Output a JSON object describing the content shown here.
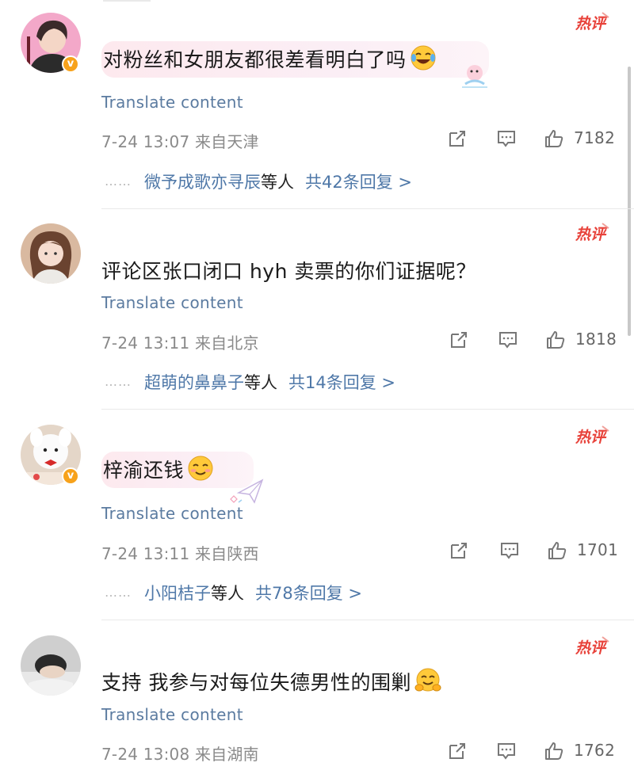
{
  "translate_label": "Translate content",
  "hot_badge_label": "热评",
  "comments": [
    {
      "text": "对粉丝和女朋友都很差看明白了吗",
      "emoji": "laughing-tears-emoji",
      "verified": true,
      "meta": "7-24 13:07  来自天津",
      "likes": "7182",
      "replies": {
        "dots": "……",
        "names": "微予成歌亦寻辰",
        "etc": "等人",
        "total": "共42条回复 >"
      }
    },
    {
      "text": "评论区张口闭口 hyh 卖票的你们证据呢？",
      "emoji": "",
      "verified": false,
      "meta": "7-24 13:11  来自北京",
      "likes": "1818",
      "replies": {
        "dots": "……",
        "names": "超萌的鼻鼻子",
        "etc": "等人",
        "total": "共14条回复 >"
      }
    },
    {
      "text": "梓渝还钱",
      "emoji": "smiling-blush-emoji",
      "verified": true,
      "meta": "7-24 13:11  来自陕西",
      "likes": "1701",
      "replies": {
        "dots": "……",
        "names": "小阳桔子",
        "etc": "等人",
        "total": "共78条回复 >"
      }
    },
    {
      "text": "支持 我参与对每位失德男性的围剿",
      "emoji": "hugging-face-emoji",
      "verified": false,
      "meta": "7-24 13:08  来自湖南",
      "likes": "1762"
    }
  ],
  "colors": {
    "link": "#5b7ba0",
    "reply_names": "#4f78a8",
    "hot_badge": "#e8423a",
    "verified_badge": "#f7a21b"
  }
}
